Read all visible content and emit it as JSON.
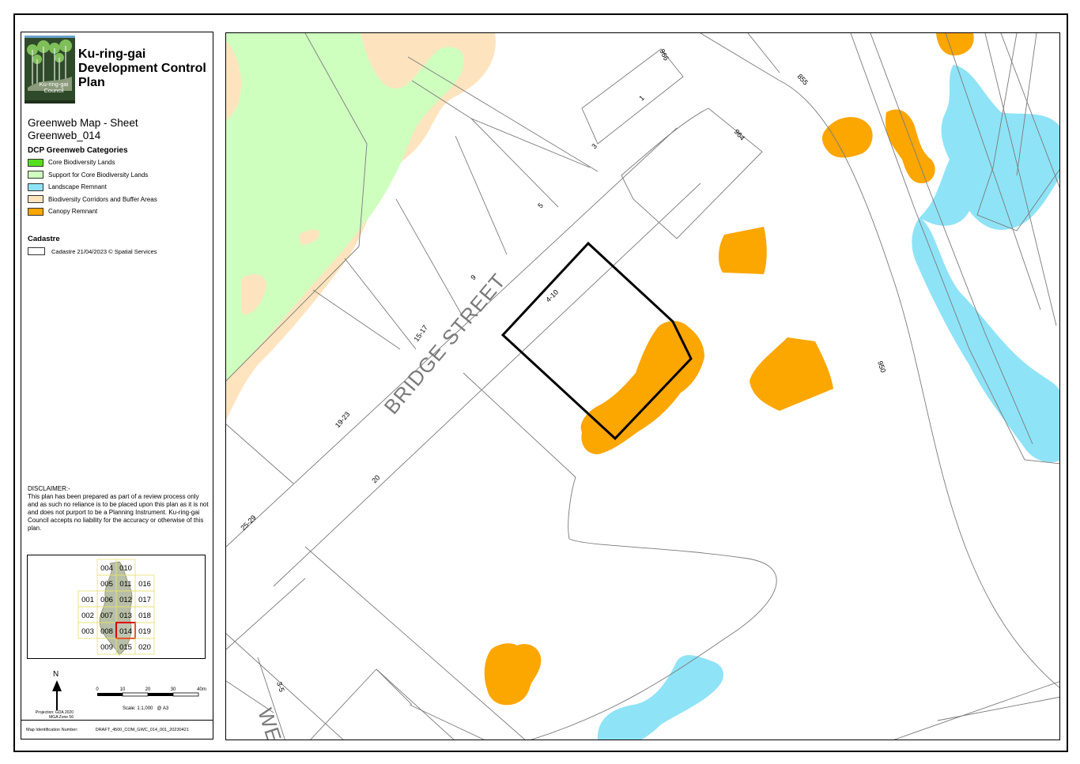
{
  "doc": {
    "title": "Ku-ring-gai Development Control Plan",
    "logo_text": "Ku-ring-gai Council",
    "sheet_title": "Greenweb Map - Sheet Greenweb_014"
  },
  "legend": {
    "heading": "DCP Greenweb Categories",
    "categories": [
      {
        "label": "Core Biodiversity Lands",
        "color": "#55e01e"
      },
      {
        "label": "Support for Core Biodiversity Lands",
        "color": "#cfffbf"
      },
      {
        "label": "Landscape Remnant",
        "color": "#8fe3f7"
      },
      {
        "label": "Biodiversity Corridors and Buffer Areas",
        "color": "#fde4be"
      },
      {
        "label": "Canopy Remnant",
        "color": "#fca600"
      }
    ],
    "cadastre_heading": "Cadastre",
    "cadastre_label": "Cadastre 21/04/2023 © Spatial Services"
  },
  "disclaimer": {
    "heading": "DISCLAIMER:-",
    "text": "This plan has been prepared as part of a review process only and as such no reliance is to be placed upon this plan as it is not and does not purport to be a Planning Instrument. Ku-ring-gai Council accepts no liability for the accuracy or otherwise of this plan."
  },
  "inset": {
    "sheets": [
      "004",
      "010",
      "005",
      "011",
      "016",
      "001",
      "006",
      "012",
      "017",
      "002",
      "007",
      "013",
      "018",
      "003",
      "008",
      "014",
      "019",
      "009",
      "015",
      "020"
    ],
    "current_sheet": "014"
  },
  "north": "N",
  "projection": "Projection: GDA 2020 MGA Zone 56",
  "scale": {
    "ticks": [
      "0",
      "10",
      "20",
      "30",
      "40m"
    ],
    "text": "Scale: 1:1,000",
    "paper": "@ A3"
  },
  "map_id": {
    "label": "Map Identification Number:",
    "value": "DRAFT_4500_COM_GWC_014_001_20230421"
  },
  "map": {
    "street_name": "BRIDGE STREET",
    "street_partial": "WE",
    "lots": [
      "966",
      "1",
      "855",
      "3",
      "964",
      "5",
      "9",
      "4-10",
      "15-17",
      "950",
      "19-23",
      "20",
      "25-29",
      "3-5"
    ],
    "colors": {
      "support": "#cfffbf",
      "buffer": "#fde4be",
      "landscape": "#8fe3f7",
      "canopy": "#fca600",
      "lot_outline": "#7a7a7a",
      "subject_outline": "#000000"
    }
  }
}
